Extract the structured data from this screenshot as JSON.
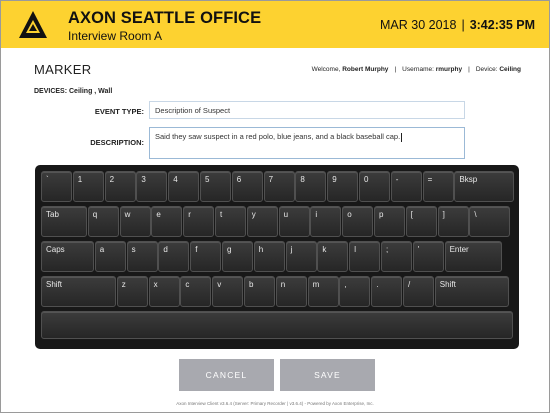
{
  "header": {
    "title": "AXON SEATTLE OFFICE",
    "subtitle": "Interview Room A",
    "date": "MAR 30 2018",
    "separator": "|",
    "time": "3:42:35  PM"
  },
  "page_title": "MARKER",
  "user_info": {
    "welcome_label": "Welcome,",
    "welcome_name": "Robert  Murphy",
    "username_label": "Username:",
    "username": "rmurphy",
    "device_label": "Device:",
    "device": "Ceiling",
    "separator": "|"
  },
  "devices": "DEVICES: Ceiling , Wall",
  "form": {
    "event_type_label": "EVENT TYPE:",
    "event_type_value": "Description of Suspect",
    "description_label": "DESCRIPTION:",
    "description_value": "Said they saw suspect in a red polo, blue jeans, and a black baseball cap."
  },
  "keyboard": {
    "rows": [
      [
        "`",
        "1",
        "2",
        "3",
        "4",
        "5",
        "6",
        "7",
        "8",
        "9",
        "0",
        "-",
        "=",
        "Bksp"
      ],
      [
        "Tab",
        "q",
        "w",
        "e",
        "r",
        "t",
        "y",
        "u",
        "i",
        "o",
        "p",
        "[",
        "]",
        "\\"
      ],
      [
        "Caps",
        "a",
        "s",
        "d",
        "f",
        "g",
        "h",
        "j",
        "k",
        "l",
        ";",
        "'",
        "Enter"
      ],
      [
        "Shift",
        "z",
        "x",
        "c",
        "v",
        "b",
        "n",
        "m",
        ",",
        ".",
        "/",
        "Shift"
      ],
      [
        " "
      ]
    ]
  },
  "buttons": {
    "cancel": "CANCEL",
    "save": "SAVE"
  },
  "footer": "Axon Interview Client v3.6.4 (Server: Primary Recorder | v3.6.4) - Powered by Axon Enterprise, Inc.",
  "colors": {
    "header_bg": "#fdd230",
    "keyboard_bg": "#181818",
    "button_bg": "#a8a9af"
  }
}
